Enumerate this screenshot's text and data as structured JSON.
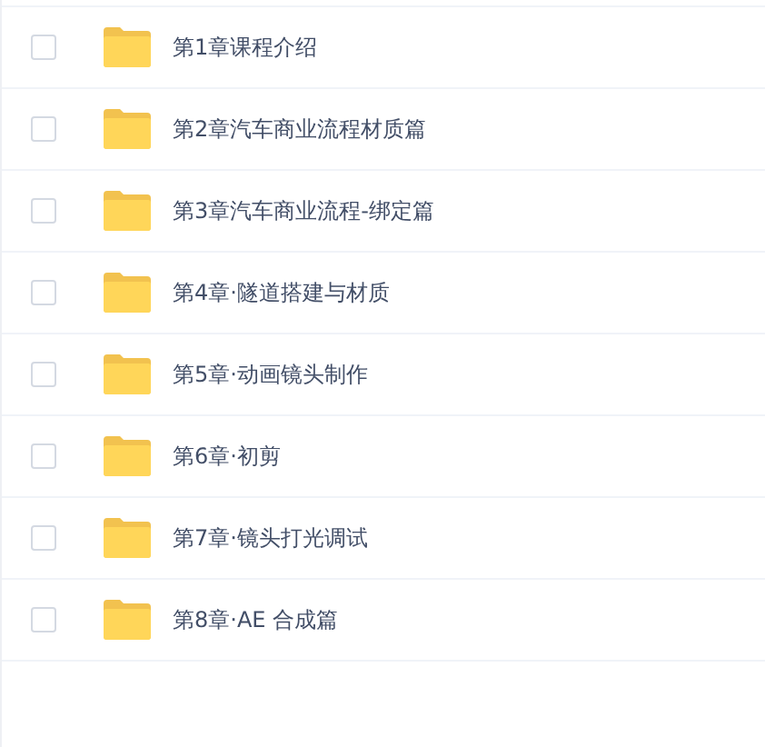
{
  "files": [
    {
      "name": "第1章课程介绍",
      "checked": false
    },
    {
      "name": "第2章汽车商业流程材质篇",
      "checked": false
    },
    {
      "name": "第3章汽车商业流程-绑定篇",
      "checked": false
    },
    {
      "name": "第4章·隧道搭建与材质",
      "checked": false
    },
    {
      "name": "第5章·动画镜头制作",
      "checked": false
    },
    {
      "name": "第6章·初剪",
      "checked": false
    },
    {
      "name": "第7章·镜头打光调试",
      "checked": false
    },
    {
      "name": "第8章·AE 合成篇",
      "checked": false
    }
  ]
}
